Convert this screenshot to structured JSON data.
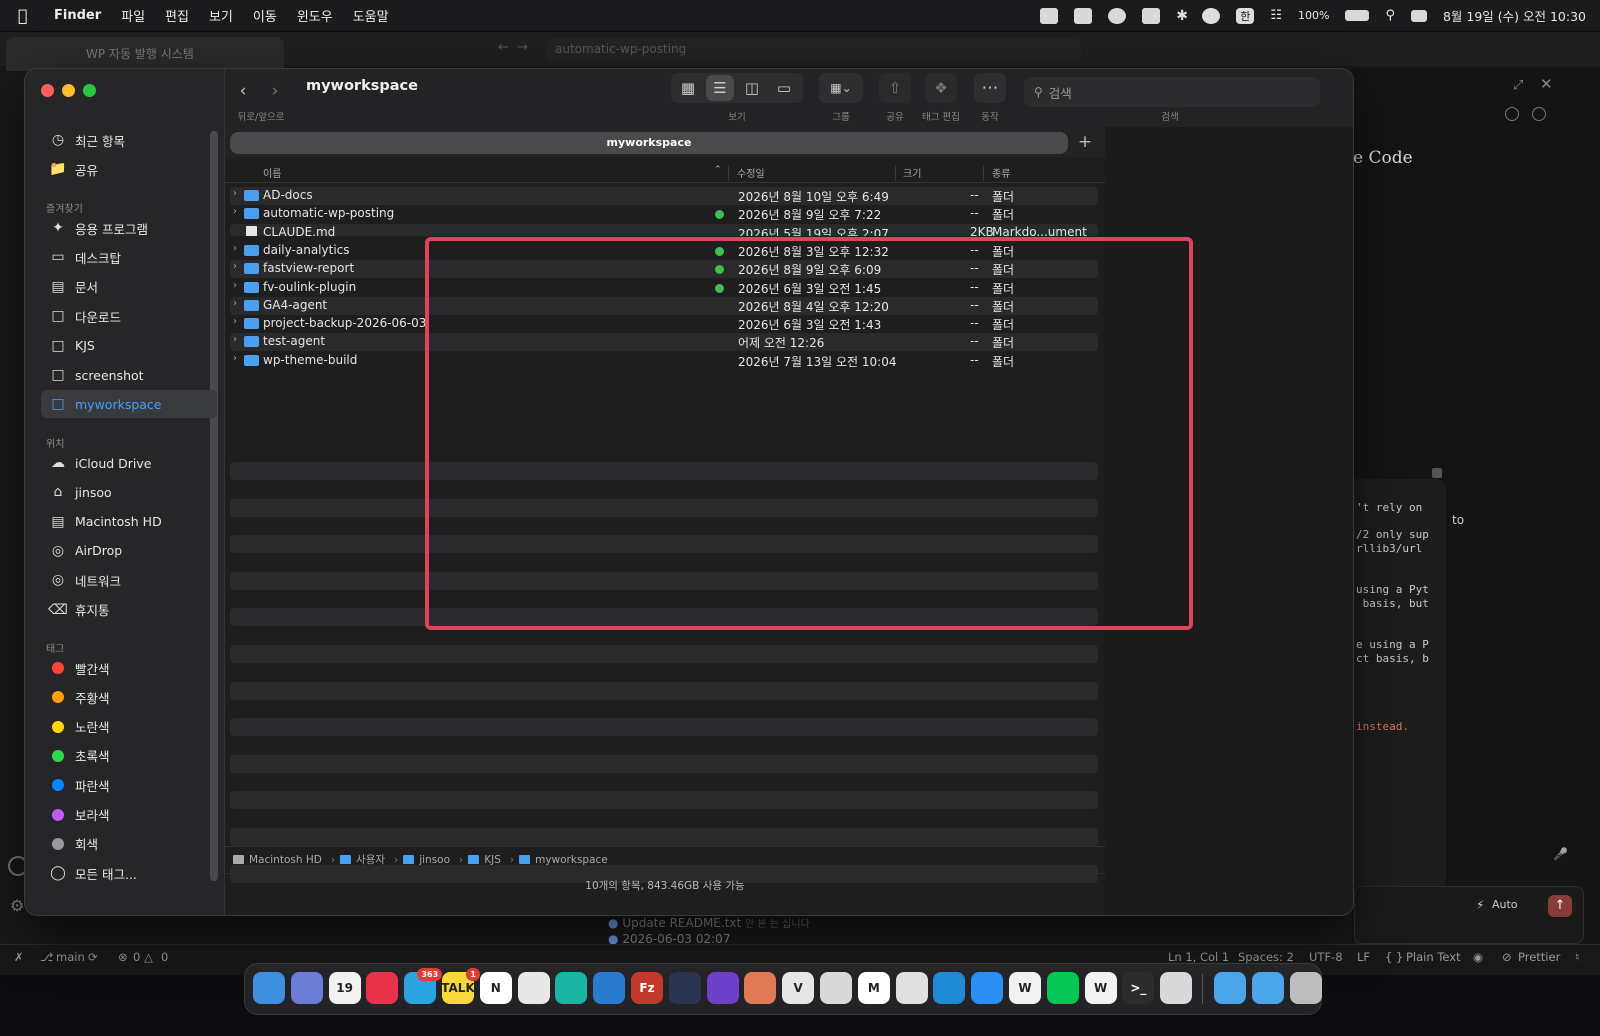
{
  "menubar": {
    "app": "Finder",
    "items": [
      "파일",
      "편집",
      "보기",
      "이동",
      "윈도우",
      "도움말"
    ],
    "battery": "100%",
    "ime": "한",
    "datetime": "8월 19일 (수) 오전 10:30"
  },
  "vscode": {
    "window_tab": "WP 자동 발행 시스템",
    "url": "automatic-wp-posting",
    "panel_title": "e Code",
    "code_lines": [
      "'t rely on",
      "/2 only sup",
      "rllib3/url",
      "using a Pyt",
      " basis, but",
      "e using a P",
      "ct basis, b",
      "instead."
    ],
    "trailing_word": "to",
    "auto_label": "Auto",
    "git_commit": "Update README.txt",
    "git_commit_note": "안 본 는 십니다",
    "git_commit2": "2026-06-03 02:07",
    "status": {
      "branch": "main",
      "errors": "0",
      "warnings": "0",
      "position": "Ln 1, Col 1",
      "spaces": "Spaces: 2",
      "encoding": "UTF-8",
      "eol": "LF",
      "language": "Plain Text",
      "formatter": "Prettier"
    }
  },
  "finder": {
    "folder_title": "myworkspace",
    "toolbar_labels": {
      "back_forward": "뒤로/앞으로",
      "view": "보기",
      "group": "그룹",
      "share": "공유",
      "tag_edit": "태그 편집",
      "action": "동작",
      "search": "검색"
    },
    "search_placeholder": "검색",
    "tab_title": "myworkspace",
    "columns": {
      "name": "이름",
      "modified": "수정일",
      "size": "크기",
      "kind": "종류"
    },
    "sidebar": {
      "top": [
        {
          "label": "최근 항목",
          "icon": "clock-icon"
        },
        {
          "label": "공유",
          "icon": "shared-folder-icon"
        }
      ],
      "favorites_header": "즐겨찾기",
      "favorites": [
        {
          "label": "응용 프로그램",
          "icon": "applications-icon"
        },
        {
          "label": "데스크탑",
          "icon": "desktop-icon"
        },
        {
          "label": "문서",
          "icon": "document-icon"
        },
        {
          "label": "다운로드",
          "icon": "downloads-icon"
        },
        {
          "label": "KJS",
          "icon": "folder-icon"
        },
        {
          "label": "screenshot",
          "icon": "folder-icon"
        },
        {
          "label": "myworkspace",
          "icon": "folder-icon",
          "selected": true
        }
      ],
      "locations_header": "위치",
      "locations": [
        {
          "label": "iCloud Drive",
          "icon": "cloud-icon"
        },
        {
          "label": "jinsoo",
          "icon": "home-icon"
        },
        {
          "label": "Macintosh HD",
          "icon": "disk-icon"
        },
        {
          "label": "AirDrop",
          "icon": "airdrop-icon"
        },
        {
          "label": "네트워크",
          "icon": "network-icon"
        },
        {
          "label": "휴지통",
          "icon": "trash-icon"
        }
      ],
      "tags_header": "태그",
      "tags": [
        {
          "label": "빨간색",
          "color": "#ff453a"
        },
        {
          "label": "주황색",
          "color": "#ff9f0a"
        },
        {
          "label": "노란색",
          "color": "#ffd60a"
        },
        {
          "label": "초록색",
          "color": "#32d74b"
        },
        {
          "label": "파란색",
          "color": "#0a84ff"
        },
        {
          "label": "보라색",
          "color": "#bf5af2"
        },
        {
          "label": "회색",
          "color": "#98989d"
        },
        {
          "label": "모든 태그...",
          "color": ""
        }
      ]
    },
    "files": [
      {
        "name": "AD-docs",
        "type": "folder",
        "date": "2026년 8월 10일 오후 6:49",
        "size": "--",
        "kind": "폴더",
        "synced": false
      },
      {
        "name": "automatic-wp-posting",
        "type": "folder",
        "date": "2026년 8월 9일 오후 7:22",
        "size": "--",
        "kind": "폴더",
        "synced": true
      },
      {
        "name": "CLAUDE.md",
        "type": "file",
        "date": "2026년 5월 19일 오후 2:07",
        "size": "2KB",
        "kind": "Markdo...ument",
        "synced": false
      },
      {
        "name": "daily-analytics",
        "type": "folder",
        "date": "2026년 8월 3일 오후 12:32",
        "size": "--",
        "kind": "폴더",
        "synced": true
      },
      {
        "name": "fastview-report",
        "type": "folder",
        "date": "2026년 8월 9일 오후 6:09",
        "size": "--",
        "kind": "폴더",
        "synced": true
      },
      {
        "name": "fv-oulink-plugin",
        "type": "folder",
        "date": "2026년 6월 3일 오전 1:45",
        "size": "--",
        "kind": "폴더",
        "synced": true
      },
      {
        "name": "GA4-agent",
        "type": "folder",
        "date": "2026년 8월 4일 오후 12:20",
        "size": "--",
        "kind": "폴더",
        "synced": false
      },
      {
        "name": "project-backup-2026-06-03",
        "type": "folder",
        "date": "2026년 6월 3일 오전 1:43",
        "size": "--",
        "kind": "폴더",
        "synced": false
      },
      {
        "name": "test-agent",
        "type": "folder",
        "date": "어제 오전 12:26",
        "size": "--",
        "kind": "폴더",
        "synced": false
      },
      {
        "name": "wp-theme-build",
        "type": "folder",
        "date": "2026년 7월 13일 오전 10:04",
        "size": "--",
        "kind": "폴더",
        "synced": false
      }
    ],
    "path": [
      "Macintosh HD",
      "사용자",
      "jinsoo",
      "KJS",
      "myworkspace"
    ],
    "status": "10개의 항목, 843.46GB 사용 가능"
  },
  "dock": {
    "apps": [
      {
        "name": "finder-icon",
        "label": "",
        "color": "#3d8fe0"
      },
      {
        "name": "launchpad-icon",
        "label": "",
        "color": "#6b7cd6"
      },
      {
        "name": "calendar-icon",
        "label": "19",
        "color": "#f2f2f2"
      },
      {
        "name": "music-icon",
        "label": "",
        "color": "#e9334b"
      },
      {
        "name": "telegram-icon",
        "label": "",
        "color": "#2aa3e0",
        "badge": "363"
      },
      {
        "name": "kakaotalk-icon",
        "label": "TALK",
        "color": "#f6d93b",
        "badge": "1"
      },
      {
        "name": "notion-icon",
        "label": "N",
        "color": "#ffffff"
      },
      {
        "name": "slack-icon",
        "label": "",
        "color": "#e8e8e8"
      },
      {
        "name": "pycharm-icon",
        "label": "",
        "color": "#1ab5a2"
      },
      {
        "name": "vscode-icon",
        "label": "",
        "color": "#2a7bd0"
      },
      {
        "name": "filezilla-icon",
        "label": "Fz",
        "color": "#c0392b"
      },
      {
        "name": "vpn-icon",
        "label": "",
        "color": "#2a3450"
      },
      {
        "name": "github-icon",
        "label": "",
        "color": "#6e40c9"
      },
      {
        "name": "claude-icon",
        "label": "",
        "color": "#e07a55"
      },
      {
        "name": "vim-icon",
        "label": "V",
        "color": "#e6e6e6"
      },
      {
        "name": "preview-icon",
        "label": "",
        "color": "#d9d9d9"
      },
      {
        "name": "gmail-icon",
        "label": "M",
        "color": "#ffffff"
      },
      {
        "name": "chrome-icon",
        "label": "",
        "color": "#e0e0e0"
      },
      {
        "name": "edge-icon",
        "label": "",
        "color": "#1f8ad6"
      },
      {
        "name": "safari-icon",
        "label": "",
        "color": "#2b8ef2"
      },
      {
        "name": "word-icon",
        "label": "W",
        "color": "#f2f2f2"
      },
      {
        "name": "line-icon",
        "label": "",
        "color": "#06c755"
      },
      {
        "name": "word2-icon",
        "label": "W",
        "color": "#f2f2f2"
      },
      {
        "name": "terminal-icon",
        "label": ">_",
        "color": "#2c2c2c"
      },
      {
        "name": "script-icon",
        "label": "",
        "color": "#d8d8d8"
      },
      {
        "name": "downloads-folder-icon",
        "label": "",
        "color": "#4aa6e8"
      },
      {
        "name": "documents-folder-icon",
        "label": "",
        "color": "#4aa6e8"
      },
      {
        "name": "trash-dock-icon",
        "label": "",
        "color": "#bdbdbd"
      }
    ]
  }
}
